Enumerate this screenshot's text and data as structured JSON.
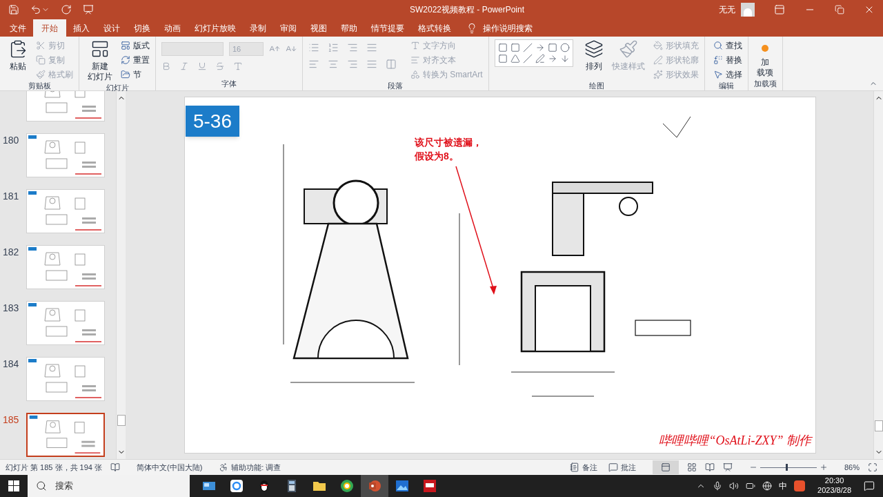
{
  "title_bar": {
    "title": "SW2022视频教程  -  PowerPoint",
    "user_name": "无无"
  },
  "menu_tabs": [
    {
      "label": "文件",
      "selected": false
    },
    {
      "label": "开始",
      "selected": true
    },
    {
      "label": "插入",
      "selected": false
    },
    {
      "label": "设计",
      "selected": false
    },
    {
      "label": "切换",
      "selected": false
    },
    {
      "label": "动画",
      "selected": false
    },
    {
      "label": "幻灯片放映",
      "selected": false
    },
    {
      "label": "录制",
      "selected": false
    },
    {
      "label": "审阅",
      "selected": false
    },
    {
      "label": "视图",
      "selected": false
    },
    {
      "label": "帮助",
      "selected": false
    },
    {
      "label": "情节提要",
      "selected": false
    },
    {
      "label": "格式转换",
      "selected": false
    }
  ],
  "tell_me": "操作说明搜索",
  "ribbon_groups": [
    {
      "kind": "clipboard",
      "label": "剪贴板",
      "large": [
        {
          "lines": [
            "粘贴"
          ],
          "disabled": false
        }
      ],
      "small": [
        {
          "label": "剪切",
          "disabled": true
        },
        {
          "label": "复制",
          "disabled": true
        },
        {
          "label": "格式刷",
          "disabled": true
        }
      ]
    },
    {
      "kind": "slides",
      "label": "幻灯片",
      "large": [
        {
          "lines": [
            "新建",
            "幻灯片"
          ],
          "disabled": false
        }
      ],
      "small": [
        {
          "label": "版式",
          "disabled": false
        },
        {
          "label": "重置",
          "disabled": false
        },
        {
          "label": "节",
          "disabled": false
        }
      ]
    },
    {
      "kind": "font",
      "label": "字体",
      "font_size": "16"
    },
    {
      "kind": "paragraph",
      "label": "段落",
      "small": [
        {
          "label": "文字方向",
          "disabled": true
        },
        {
          "label": "对齐文本",
          "disabled": true
        },
        {
          "label": "转换为 SmartArt",
          "disabled": true
        }
      ]
    },
    {
      "kind": "drawing",
      "label": "绘图",
      "large": [
        {
          "lines": [
            "排列"
          ],
          "disabled": false
        },
        {
          "lines": [
            "快速样式"
          ],
          "disabled": true
        }
      ],
      "small": [
        {
          "label": "形状填充",
          "disabled": true
        },
        {
          "label": "形状轮廓",
          "disabled": true
        },
        {
          "label": "形状效果",
          "disabled": true
        }
      ]
    },
    {
      "kind": "editing",
      "label": "编辑",
      "small": [
        {
          "label": "查找",
          "disabled": false
        },
        {
          "label": "替换",
          "disabled": false
        },
        {
          "label": "选择",
          "disabled": false
        }
      ]
    },
    {
      "kind": "addins",
      "label": "加载项",
      "large": [
        {
          "lines": [
            "加",
            "载项"
          ],
          "disabled": false
        }
      ]
    }
  ],
  "thumbnails": [
    {
      "selected": false
    },
    {
      "number": "180",
      "selected": false
    },
    {
      "number": "181",
      "selected": false
    },
    {
      "number": "182",
      "selected": false
    },
    {
      "number": "183",
      "selected": false
    },
    {
      "number": "184",
      "selected": false
    },
    {
      "number": "185",
      "selected": true
    }
  ],
  "slide": {
    "tag": "5-36",
    "note": [
      "该尺寸被遗漏，",
      "假设为8。"
    ],
    "credit": "哔哩哔哩“OsAtLi-ZXY” 制作"
  },
  "status_bar": {
    "slide_info": "幻灯片 第 185 张，共 194 张",
    "language": "简体中文(中国大陆)",
    "accessibility": "辅助功能: 调查",
    "notes": "备注",
    "comments": "批注",
    "zoom": "86%",
    "zoom_level": {
      "level": 0.45
    }
  },
  "taskbar": {
    "search_placeholder": "搜索",
    "apps": [
      {
        "kind": "mail",
        "active": false
      },
      {
        "kind": "cloud",
        "active": false
      },
      {
        "kind": "penguin",
        "active": false
      },
      {
        "kind": "calculator",
        "active": false
      },
      {
        "kind": "folder",
        "active": false
      },
      {
        "kind": "browser",
        "active": false
      },
      {
        "kind": "presentation",
        "active": true
      },
      {
        "kind": "photos",
        "active": false
      },
      {
        "kind": "cad",
        "active": false
      }
    ],
    "ime": "中",
    "time": "20:30",
    "date": "2023/8/28"
  }
}
